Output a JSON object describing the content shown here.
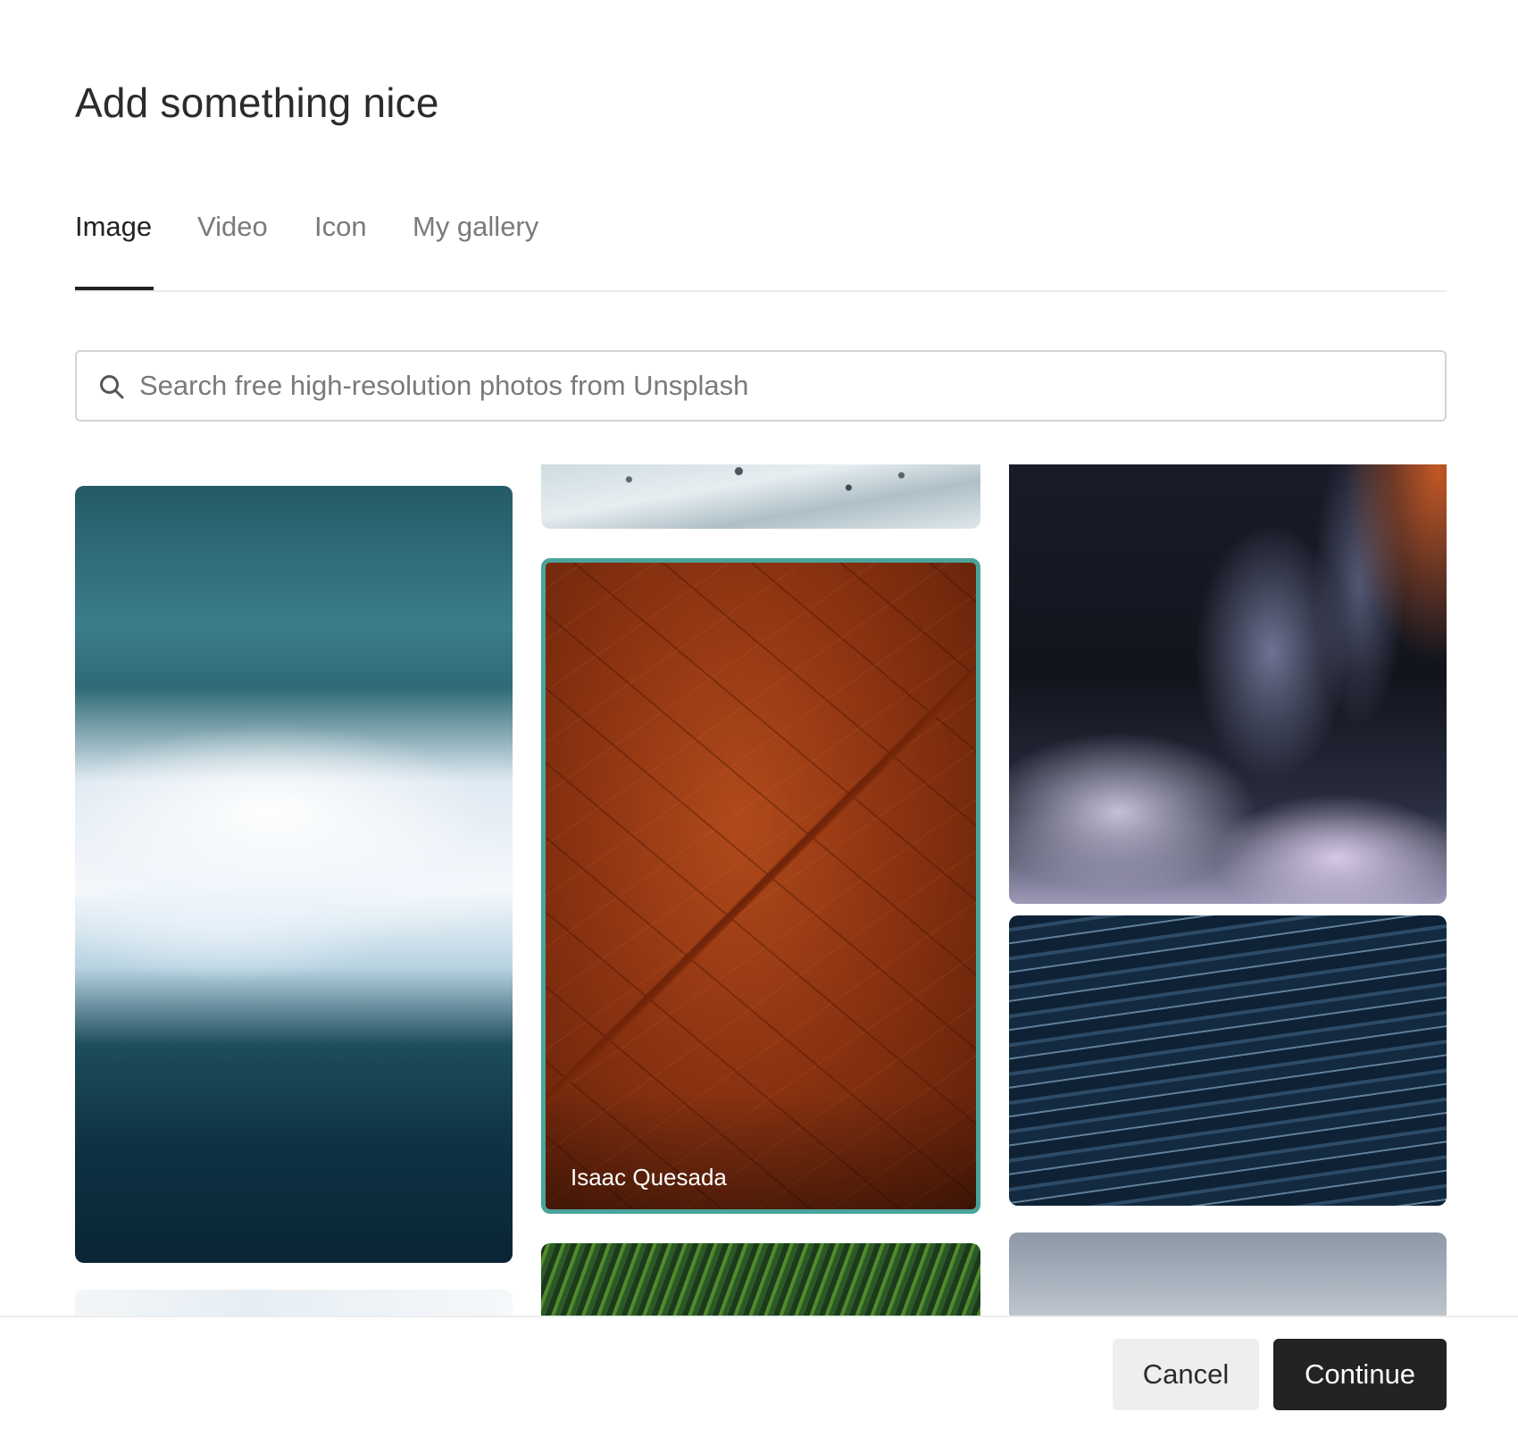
{
  "dialog": {
    "title": "Add something nice"
  },
  "tabs": [
    {
      "label": "Image",
      "active": true
    },
    {
      "label": "Video",
      "active": false
    },
    {
      "label": "Icon",
      "active": false
    },
    {
      "label": "My gallery",
      "active": false
    }
  ],
  "search": {
    "icon": "search-icon",
    "placeholder": "Search free high-resolution photos from Unsplash",
    "value": ""
  },
  "photos": {
    "selected_credit": "Isaac Quesada",
    "selected_border_color": "#4aa39a"
  },
  "footer": {
    "cancel_label": "Cancel",
    "continue_label": "Continue"
  }
}
